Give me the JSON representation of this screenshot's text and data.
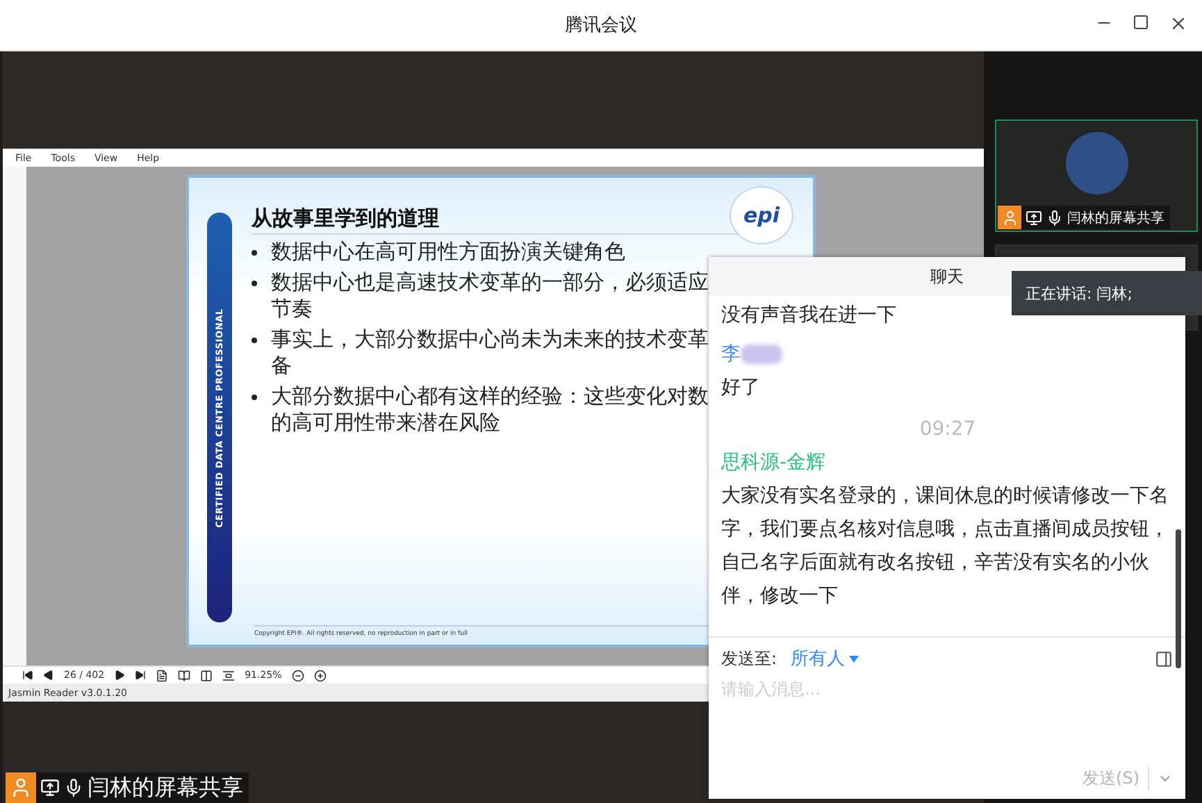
{
  "window": {
    "title": "腾讯会议"
  },
  "shared_screen": {
    "app_menu": [
      "File",
      "Tools",
      "View",
      "Help"
    ],
    "slide": {
      "title": "从故事里学到的道理",
      "bullets": [
        {
          "lines": [
            "数据中心在高可用性方面扮演关键角色"
          ]
        },
        {
          "lines": [
            "数据中心也是高速技术变革的一部分，必须适应",
            "节奏"
          ]
        },
        {
          "lines": [
            "事实上，大部分数据中心尚未为未来的技术变革",
            "备"
          ]
        },
        {
          "lines": [
            "大部分数据中心都有这样的经验：这些变化对数",
            "的高可用性带来潜在风险"
          ]
        }
      ],
      "banner": "CERTIFIED DATA CENTRE PROFESSIONAL",
      "logo": "epi",
      "copyright": "Copyright EPI®. All rights reserved, no reproduction in part or in full"
    },
    "toolbar": {
      "page": "26 / 402",
      "zoom": "91.25%"
    },
    "status": "Jasmin Reader v3.0.1.20"
  },
  "share_label": "闫林的屏幕共享",
  "participant": {
    "name": "闫林的屏幕共享"
  },
  "speaking": "正在讲话: 闫林;",
  "chat": {
    "title": "聊天",
    "messages": [
      {
        "kind": "text",
        "text": "没有声音我在进一下"
      },
      {
        "kind": "sender",
        "name": "李",
        "color": "#3d8ef0",
        "redacted": true
      },
      {
        "kind": "text",
        "text": "好了"
      },
      {
        "kind": "time",
        "text": "09:27"
      },
      {
        "kind": "sender",
        "name": "思科源-金辉",
        "color": "#26c281",
        "redacted": false
      },
      {
        "kind": "text",
        "text": "大家没有实名登录的，课间休息的时候请修改一下名字，我们要点名核对信息哦，点击直播间成员按钮，自己名字后面就有改名按钮，辛苦没有实名的小伙伴，修改一下"
      }
    ],
    "send_to_label": "发送至:",
    "recipient": "所有人",
    "placeholder": "请输入消息...",
    "send_button": {
      "label": "发送(S)",
      "disabled": true
    }
  }
}
